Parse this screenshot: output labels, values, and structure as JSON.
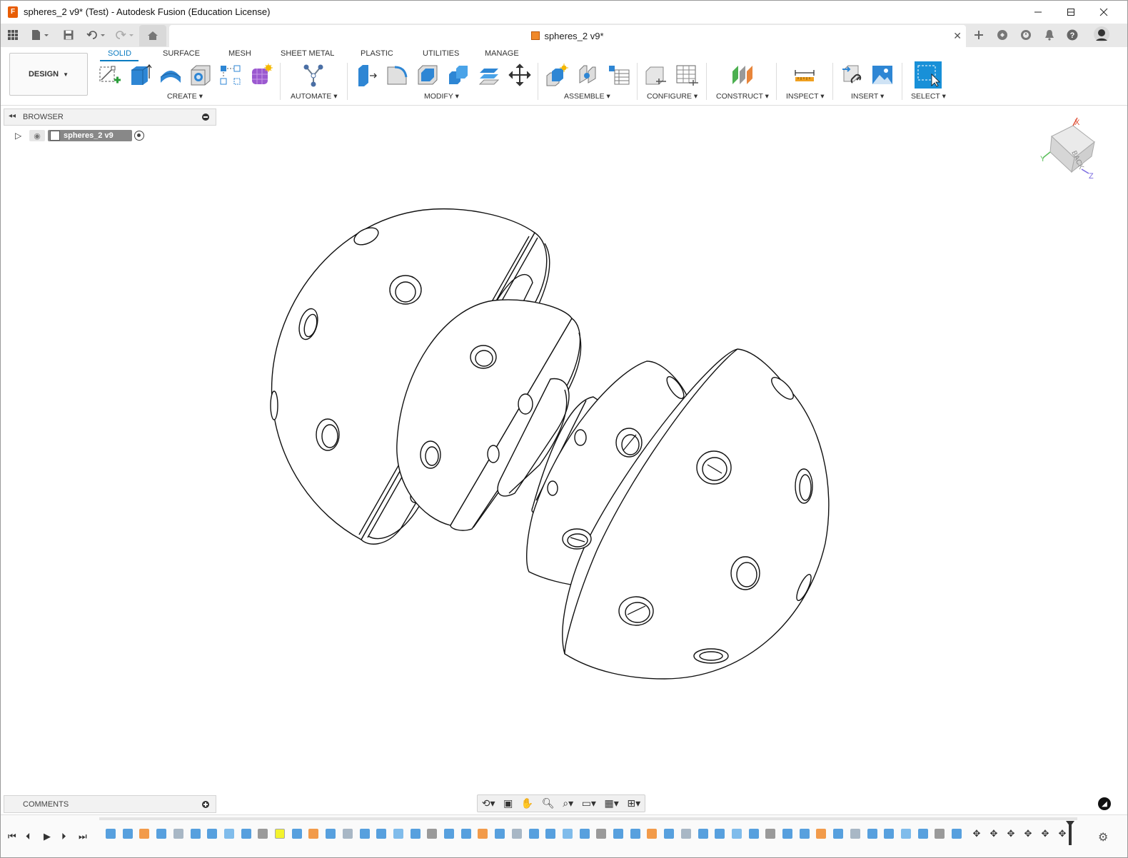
{
  "window": {
    "title": "spheres_2 v9* (Test) - Autodesk Fusion (Education License)",
    "app_icon": "fusion-logo-icon",
    "controls": [
      "minimize-icon",
      "maximize-icon",
      "close-icon"
    ]
  },
  "tabbar": {
    "document_tab": "spheres_2 v9*",
    "icons": [
      "apps-grid-icon",
      "file-icon",
      "save-icon",
      "undo-icon",
      "redo-icon",
      "home-icon",
      "new-tab-plus-icon",
      "extensions-icon",
      "job-status-icon",
      "notifications-bell-icon",
      "help-icon",
      "user-avatar"
    ]
  },
  "ribbon": {
    "workspace": "DESIGN",
    "tabs": [
      "SOLID",
      "SURFACE",
      "MESH",
      "SHEET METAL",
      "PLASTIC",
      "UTILITIES",
      "MANAGE"
    ],
    "active_tab": "SOLID",
    "groups": {
      "create": "CREATE",
      "automate": "AUTOMATE",
      "modify": "MODIFY",
      "assemble": "ASSEMBLE",
      "configure": "CONFIGURE",
      "construct": "CONSTRUCT",
      "inspect": "INSPECT",
      "insert": "INSERT",
      "select": "SELECT"
    },
    "accent": "#0a7bc1"
  },
  "browser": {
    "title": "BROWSER",
    "root_node": "spheres_2 v9"
  },
  "comments": {
    "title": "COMMENTS"
  },
  "viewcube": {
    "face": "BACK",
    "axes": [
      "X",
      "Y",
      "Z"
    ]
  }
}
